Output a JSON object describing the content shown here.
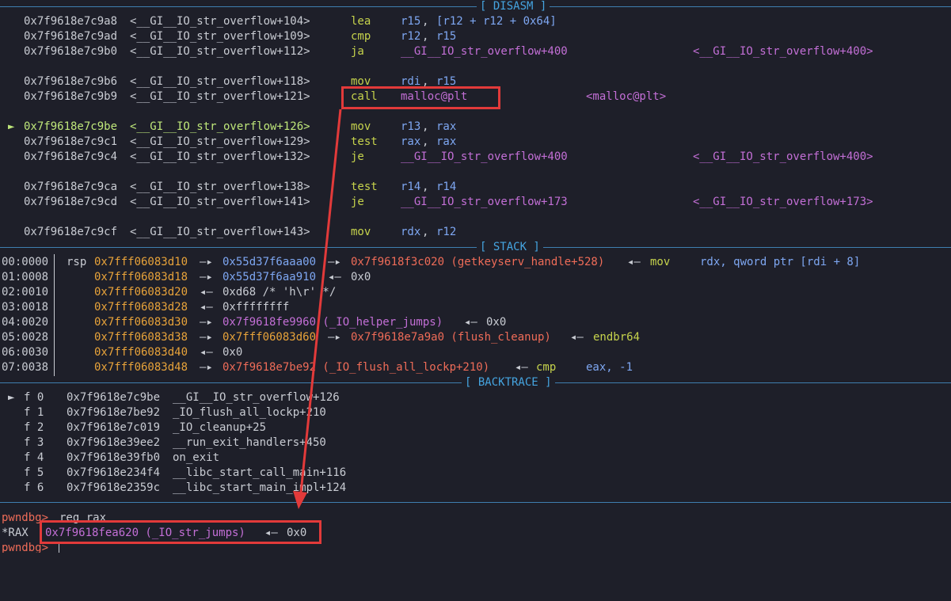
{
  "headers": {
    "disasm": "[ DISASM ]",
    "stack": "[ STACK ]",
    "backtrace": "[ BACKTRACE ]"
  },
  "disasm": [
    {
      "addr": "0x7f9618e7c9a8",
      "sym": "<__GI__IO_str_overflow+104>",
      "mn": "lea",
      "op1": "r15",
      "op2": "[r12 + r12 + 0x64]"
    },
    {
      "addr": "0x7f9618e7c9ad",
      "sym": "<__GI__IO_str_overflow+109>",
      "mn": "cmp",
      "op1": "r12",
      "op2": "r15"
    },
    {
      "addr": "0x7f9618e7c9b0",
      "sym": "<__GI__IO_str_overflow+112>",
      "mn": "ja",
      "op1": "__GI__IO_str_overflow+400",
      "tgt": "<__GI__IO_str_overflow+400>"
    },
    {
      "addr": "0x7f9618e7c9b6",
      "sym": "<__GI__IO_str_overflow+118>",
      "mn": "mov",
      "op1": "rdi",
      "op2": "r15"
    },
    {
      "addr": "0x7f9618e7c9b9",
      "sym": "<__GI__IO_str_overflow+121>",
      "mn": "call",
      "op1": "malloc@plt",
      "tgt": "<malloc@plt>"
    },
    {
      "marker": "►",
      "addr": "0x7f9618e7c9be",
      "sym": "<__GI__IO_str_overflow+126>",
      "mn": "mov",
      "op1": "r13",
      "op2": "rax"
    },
    {
      "addr": "0x7f9618e7c9c1",
      "sym": "<__GI__IO_str_overflow+129>",
      "mn": "test",
      "op1": "rax",
      "op2": "rax"
    },
    {
      "addr": "0x7f9618e7c9c4",
      "sym": "<__GI__IO_str_overflow+132>",
      "mn": "je",
      "op1": "__GI__IO_str_overflow+400",
      "tgt": "<__GI__IO_str_overflow+400>"
    },
    {
      "addr": "0x7f9618e7c9ca",
      "sym": "<__GI__IO_str_overflow+138>",
      "mn": "test",
      "op1": "r14",
      "op2": "r14"
    },
    {
      "addr": "0x7f9618e7c9cd",
      "sym": "<__GI__IO_str_overflow+141>",
      "mn": "je",
      "op1": "__GI__IO_str_overflow+173",
      "tgt": "<__GI__IO_str_overflow+173>"
    },
    {
      "addr": "0x7f9618e7c9cf",
      "sym": "<__GI__IO_str_overflow+143>",
      "mn": "mov",
      "op1": "rdx",
      "op2": "r12"
    }
  ],
  "stack": [
    {
      "idx": "00:0000",
      "reg": "rsp",
      "addr": "0x7fff06083d10",
      "a2": "0x55d37f6aaa00",
      "a3": "0x7f9618f3c020 (getkeyserv_handle+528)",
      "a4": "mov",
      "a5": "rdx, qword ptr [rdi + 8]"
    },
    {
      "idx": "01:0008",
      "addr": "0x7fff06083d18",
      "a2": "0x55d37f6aa910",
      "a3": "0x0"
    },
    {
      "idx": "02:0010",
      "addr": "0x7fff06083d20",
      "a2": "0xd68 /* 'h\\r' */"
    },
    {
      "idx": "03:0018",
      "addr": "0x7fff06083d28",
      "a2": "0xffffffff"
    },
    {
      "idx": "04:0020",
      "addr": "0x7fff06083d30",
      "a2": "0x7f9618fe9960 (_IO_helper_jumps)",
      "a3": "0x0"
    },
    {
      "idx": "05:0028",
      "addr": "0x7fff06083d38",
      "a2": "0x7fff06083d60",
      "a3": "0x7f9618e7a9a0 (flush_cleanup)",
      "a4": "endbr64"
    },
    {
      "idx": "06:0030",
      "addr": "0x7fff06083d40",
      "a2": "0x0"
    },
    {
      "idx": "07:0038",
      "addr": "0x7fff06083d48",
      "a2": "0x7f9618e7be92 (_IO_flush_all_lockp+210)",
      "a4": "cmp",
      "a5": "eax, -1"
    }
  ],
  "backtrace": [
    {
      "marker": "►",
      "f": "f 0",
      "addr": "0x7f9618e7c9be",
      "sym": "__GI__IO_str_overflow+126"
    },
    {
      "f": "f 1",
      "addr": "0x7f9618e7be92",
      "sym": "_IO_flush_all_lockp+210"
    },
    {
      "f": "f 2",
      "addr": "0x7f9618e7c019",
      "sym": "_IO_cleanup+25"
    },
    {
      "f": "f 3",
      "addr": "0x7f9618e39ee2",
      "sym": "__run_exit_handlers+450"
    },
    {
      "f": "f 4",
      "addr": "0x7f9618e39fb0",
      "sym": "on_exit"
    },
    {
      "f": "f 5",
      "addr": "0x7f9618e234f4",
      "sym": "__libc_start_call_main+116"
    },
    {
      "f": "f 6",
      "addr": "0x7f9618e2359c",
      "sym": "__libc_start_main_impl+124"
    }
  ],
  "console": {
    "prompt": "pwndbg>",
    "cmd": "reg rax",
    "rax_label": "*RAX",
    "rax_value": "0x7f9618fea620 (_IO_str_jumps)",
    "rax_arrow": "◂—",
    "rax_deref": "0x0"
  },
  "arrow": {
    "right": "—▸",
    "left": "◂—"
  },
  "colors": {
    "highlight": "#e23a3a",
    "separator": "#3f7fb0"
  }
}
